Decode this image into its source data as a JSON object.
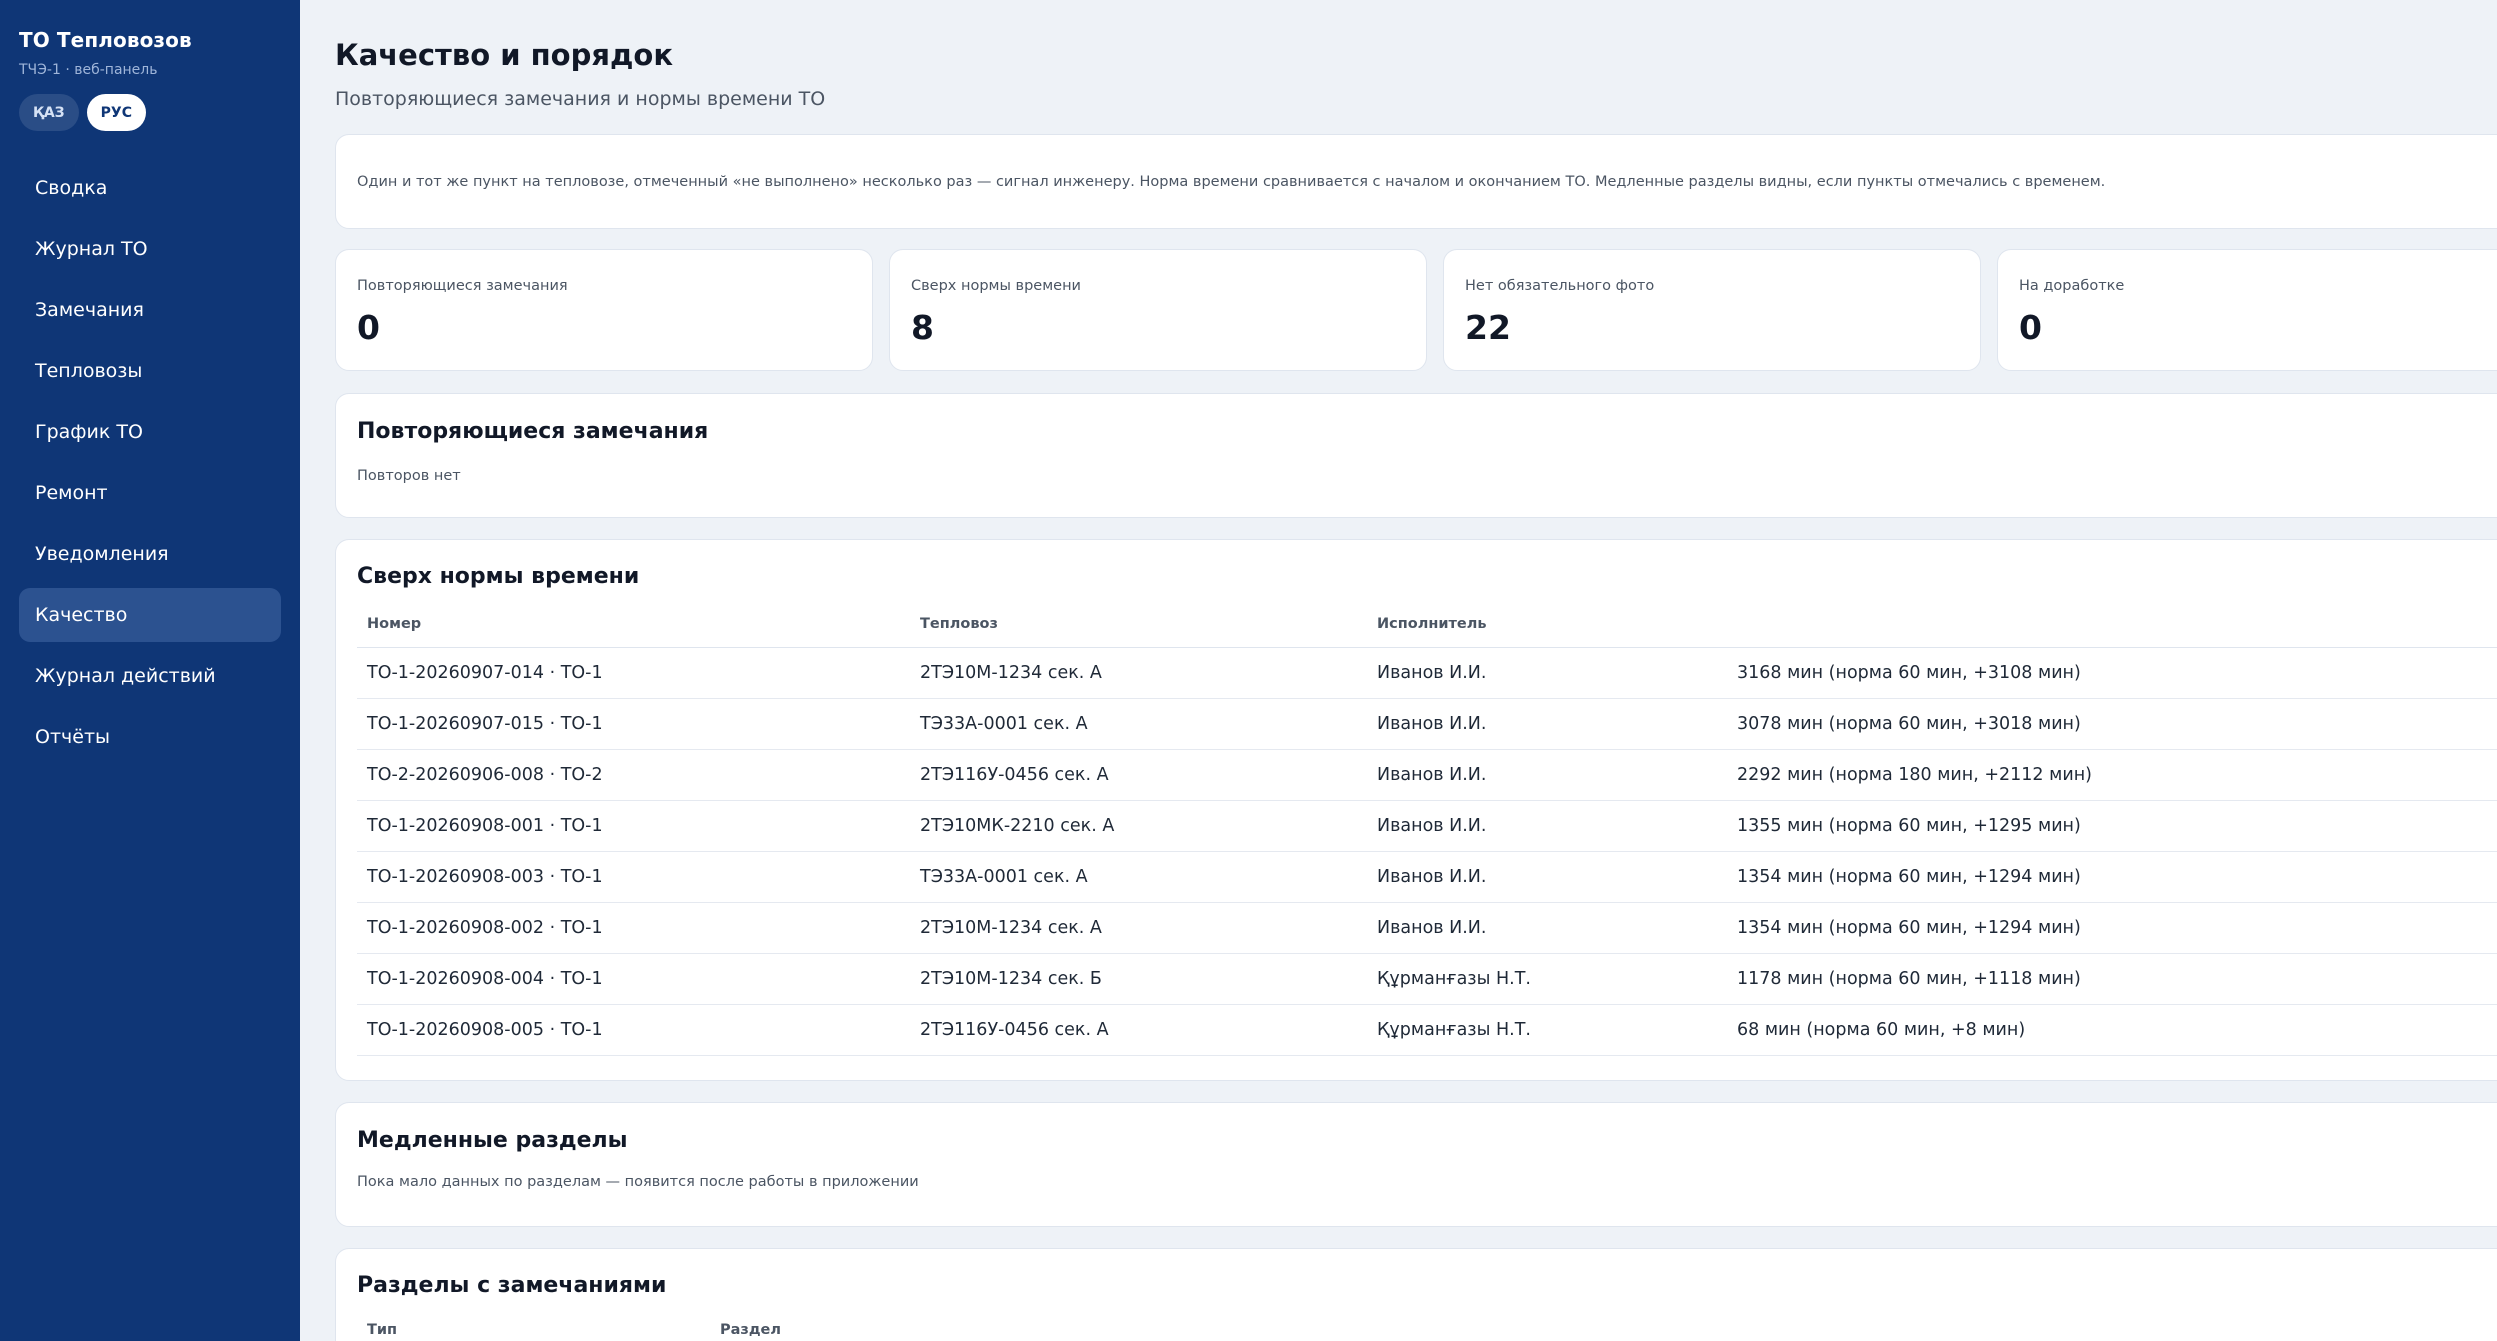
{
  "sidebar": {
    "title": "ТО Тепловозов",
    "subtitle": "ТЧЭ-1 · веб-панель",
    "lang": [
      {
        "label": "ҚАЗ",
        "active": false
      },
      {
        "label": "РУС",
        "active": true
      }
    ],
    "nav": [
      {
        "label": "Сводка"
      },
      {
        "label": "Журнал ТО"
      },
      {
        "label": "Замечания"
      },
      {
        "label": "Тепловозы"
      },
      {
        "label": "График ТО"
      },
      {
        "label": "Ремонт"
      },
      {
        "label": "Уведомления"
      },
      {
        "label": "Качество",
        "active": true
      },
      {
        "label": "Журнал действий"
      },
      {
        "label": "Отчёты"
      }
    ]
  },
  "page": {
    "title": "Качество и порядок",
    "subtitle": "Повторяющиеся замечания и нормы времени ТО",
    "info": "Один и тот же пункт на тепловозе, отмеченный «не выполнено» несколько раз — сигнал инженеру. Норма времени сравнивается с началом и окончанием ТО. Медленные разделы видны, если пункты отмечались с временем."
  },
  "kpis": [
    {
      "label": "Повторяющиеся замечания",
      "value": "0"
    },
    {
      "label": "Сверх нормы времени",
      "value": "8"
    },
    {
      "label": "Нет обязательного фото",
      "value": "22"
    },
    {
      "label": "На доработке",
      "value": "0"
    }
  ],
  "repeat_section": {
    "title": "Повторяющиеся замечания",
    "empty": "Повторов нет"
  },
  "overtime_section": {
    "title": "Сверх нормы времени",
    "columns": {
      "number": "Номер",
      "loco": "Тепловоз",
      "executor": "Исполнитель",
      "time": ""
    },
    "rows": [
      {
        "number": "ТО-1-20260907-014 · ТО-1",
        "loco": "2ТЭ10М-1234 сек. А",
        "executor": "Иванов И.И.",
        "time": "3168 мин (норма 60 мин, +3108 мин)"
      },
      {
        "number": "ТО-1-20260907-015 · ТО-1",
        "loco": "ТЭ33А-0001 сек. А",
        "executor": "Иванов И.И.",
        "time": "3078 мин (норма 60 мин, +3018 мин)"
      },
      {
        "number": "ТО-2-20260906-008 · ТО-2",
        "loco": "2ТЭ116У-0456 сек. А",
        "executor": "Иванов И.И.",
        "time": "2292 мин (норма 180 мин, +2112 мин)"
      },
      {
        "number": "ТО-1-20260908-001 · ТО-1",
        "loco": "2ТЭ10МК-2210 сек. А",
        "executor": "Иванов И.И.",
        "time": "1355 мин (норма 60 мин, +1295 мин)"
      },
      {
        "number": "ТО-1-20260908-003 · ТО-1",
        "loco": "ТЭ33А-0001 сек. А",
        "executor": "Иванов И.И.",
        "time": "1354 мин (норма 60 мин, +1294 мин)"
      },
      {
        "number": "ТО-1-20260908-002 · ТО-1",
        "loco": "2ТЭ10М-1234 сек. А",
        "executor": "Иванов И.И.",
        "time": "1354 мин (норма 60 мин, +1294 мин)"
      },
      {
        "number": "ТО-1-20260908-004 · ТО-1",
        "loco": "2ТЭ10М-1234 сек. Б",
        "executor": "Құрманғазы Н.Т.",
        "time": "1178 мин (норма 60 мин, +1118 мин)"
      },
      {
        "number": "ТО-1-20260908-005 · ТО-1",
        "loco": "2ТЭ116У-0456 сек. А",
        "executor": "Құрманғазы Н.Т.",
        "time": "68 мин (норма 60 мин, +8 мин)"
      }
    ]
  },
  "slow_section": {
    "title": "Медленные разделы",
    "empty": "Пока мало данных по разделам — появится после работы в приложении"
  },
  "defects_section": {
    "title": "Разделы с замечаниями",
    "columns": {
      "type": "Тип",
      "section": "Раздел"
    }
  }
}
